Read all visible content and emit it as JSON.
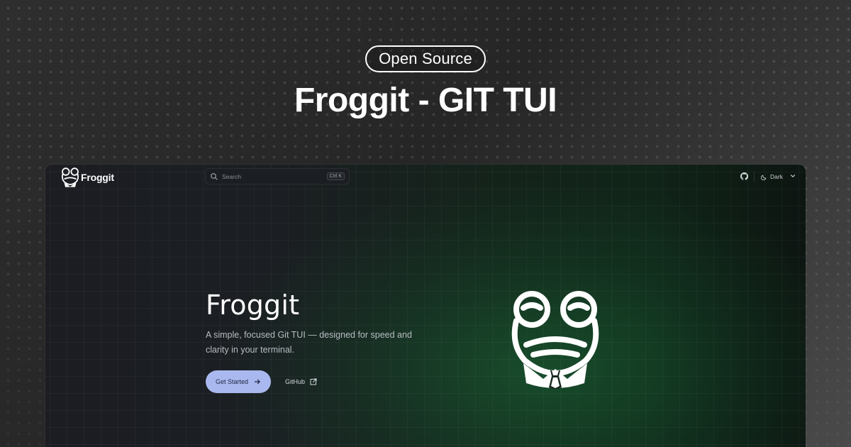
{
  "banner": {
    "badge": "Open Source",
    "title": "Froggit - GIT TUI"
  },
  "window": {
    "navbar": {
      "logo_text": "Froggit",
      "search": {
        "placeholder": "Search",
        "shortcut": "Ctrl K"
      },
      "github_icon": "github-icon",
      "theme_label": "Dark",
      "theme_icon": "moon-icon",
      "dropdown_icon": "chevron-down-icon"
    },
    "hero": {
      "title": "Froggit",
      "description": "A simple, focused Git TUI — designed for speed and clarity in your terminal.",
      "primary_button": "Get Started",
      "secondary_link": "GitHub"
    },
    "colors": {
      "accent": "#a9b8ee",
      "bg_dark": "#1b1d22",
      "bg_green": "#14331f"
    }
  }
}
